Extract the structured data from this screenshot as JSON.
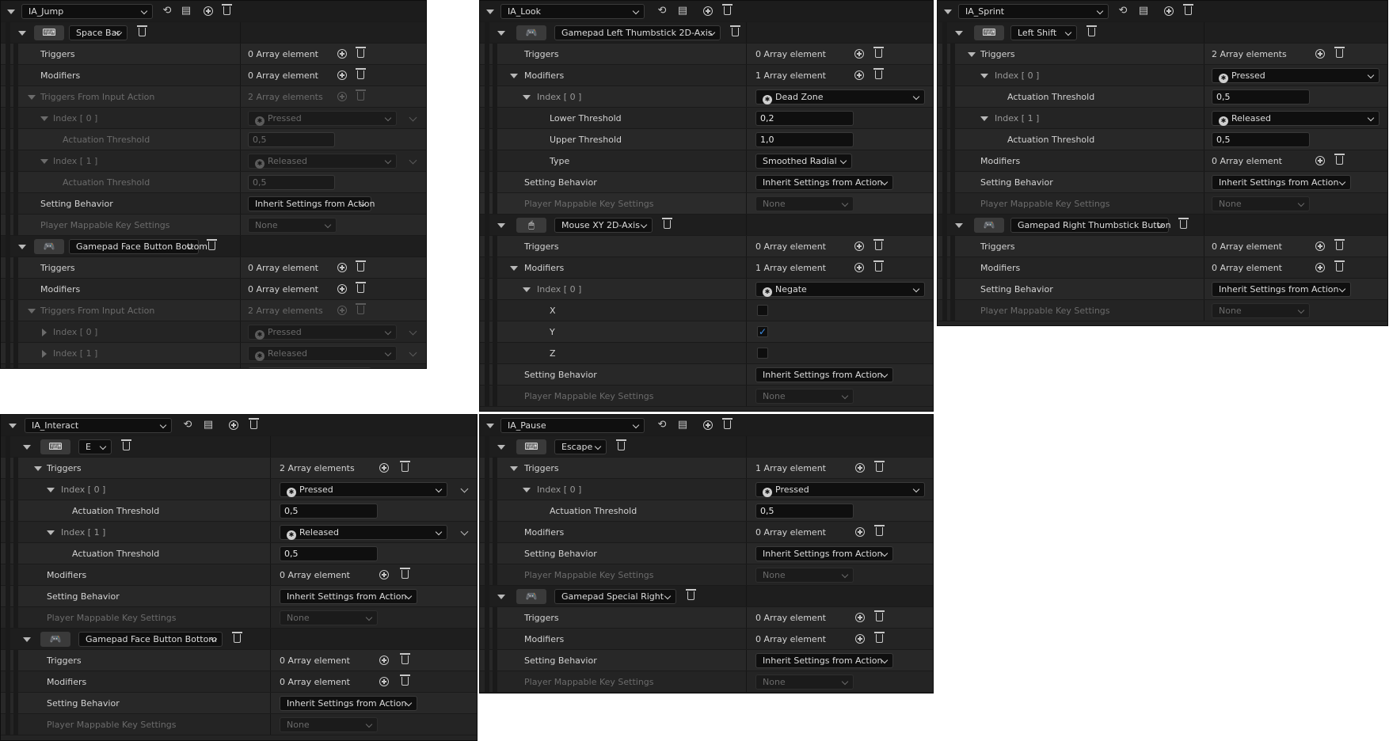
{
  "common": {
    "triggers": "Triggers",
    "modifiers": "Modifiers",
    "triggers_from_input_action": "Triggers From Input Action",
    "actuation_threshold": "Actuation Threshold",
    "setting_behavior": "Setting Behavior",
    "player_mappable": "Player Mappable Key Settings",
    "inherit": "Inherit Settings from Action",
    "none": "None",
    "zero_array": "0 Array element",
    "one_array": "1 Array element",
    "two_array": "2 Array elements",
    "pressed": "Pressed",
    "released": "Released",
    "index0": "Index [ 0 ]",
    "index1": "Index [ 1 ]",
    "val_05": "0,5",
    "keyboard_icon": "keyboard-icon",
    "gamepad_icon": "gamepad-icon",
    "mouse_icon": "mouse-icon"
  },
  "jump": {
    "action": "IA_Jump",
    "key1": "Space Bar",
    "key2": "Gamepad Face Button Bottom"
  },
  "look": {
    "action": "IA_Look",
    "key1": "Gamepad Left Thumbstick 2D-Axis",
    "dead_zone": "Dead Zone",
    "lower_threshold": "Lower Threshold",
    "lower_value": "0,2",
    "upper_threshold": "Upper Threshold",
    "upper_value": "1,0",
    "type_label": "Type",
    "type_value": "Smoothed Radial",
    "key2": "Mouse XY 2D-Axis",
    "negate": "Negate",
    "x": "X",
    "y": "Y",
    "z": "Z",
    "check": "✓"
  },
  "sprint": {
    "action": "IA_Sprint",
    "key1": "Left Shift",
    "key2": "Gamepad Right Thumbstick Button"
  },
  "interact": {
    "action": "IA_Interact",
    "key1": "E",
    "key2": "Gamepad Face Button Bottom"
  },
  "pause": {
    "action": "IA_Pause",
    "key1": "Escape",
    "key2": "Gamepad Special Right"
  }
}
